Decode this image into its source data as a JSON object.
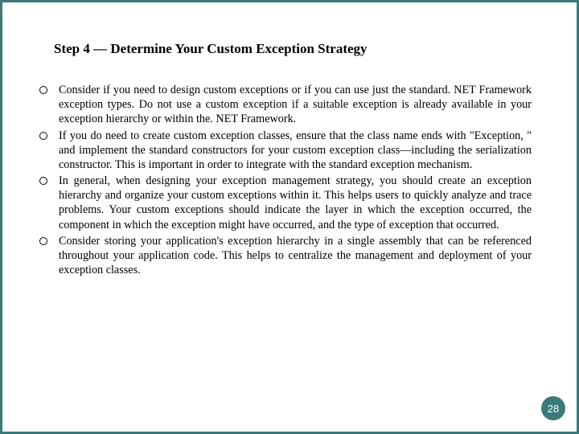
{
  "title": "Step 4 — Determine Your Custom Exception Strategy",
  "bullets": [
    "Consider if you need to design custom exceptions or if you can use just the standard. NET Framework exception types. Do not use a custom exception if a suitable exception is already available in your exception hierarchy or within the. NET Framework.",
    "If you do need to create custom exception classes, ensure that the class name ends with \"Exception, \" and implement the standard constructors for your custom exception class—including the serialization constructor. This is important in order to integrate with the standard exception mechanism.",
    "In general, when designing your exception management strategy, you should create an exception hierarchy and organize your custom exceptions within it. This helps users to quickly analyze and trace problems. Your custom exceptions should indicate the layer in which the exception occurred, the component in which the exception might have occurred, and the type of exception that occurred.",
    "Consider storing your application's exception hierarchy in a single assembly that can be referenced throughout your application code. This helps to centralize the management and deployment of your exception classes."
  ],
  "page_number": "28",
  "colors": {
    "accent": "#3a7a7a"
  }
}
